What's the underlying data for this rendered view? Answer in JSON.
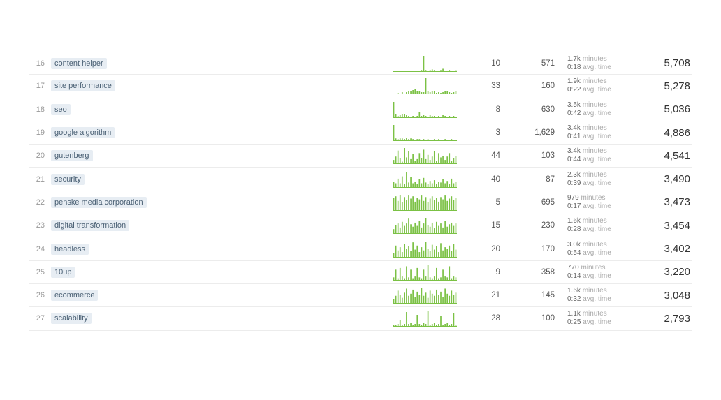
{
  "labels": {
    "minutes": "minutes",
    "avg_time": "avg. time"
  },
  "rows": [
    {
      "rank": 16,
      "tag": "content helper",
      "spark": [
        0,
        0,
        0,
        1,
        0,
        0,
        0,
        0,
        0,
        1,
        0,
        0,
        0,
        2,
        25,
        2,
        1,
        2,
        3,
        2,
        1,
        1,
        2,
        4,
        0,
        1,
        2,
        1,
        1,
        2
      ],
      "col1": "10",
      "col2": "571",
      "minutes": "1.7k",
      "avg_time": "0:18",
      "total": "5,708"
    },
    {
      "rank": 17,
      "tag": "site performance",
      "spark": [
        0,
        0,
        1,
        0,
        2,
        0,
        2,
        4,
        3,
        5,
        6,
        3,
        4,
        2,
        2,
        22,
        3,
        2,
        3,
        4,
        1,
        2,
        1,
        2,
        3,
        4,
        2,
        1,
        2,
        4
      ],
      "col1": "33",
      "col2": "160",
      "minutes": "1.9k",
      "avg_time": "0:22",
      "total": "5,278"
    },
    {
      "rank": 18,
      "tag": "seo",
      "spark": [
        22,
        4,
        2,
        3,
        5,
        4,
        3,
        2,
        1,
        2,
        1,
        2,
        7,
        2,
        3,
        2,
        1,
        3,
        2,
        2,
        1,
        2,
        1,
        3,
        2,
        1,
        2,
        1,
        2,
        1
      ],
      "col1": "8",
      "col2": "630",
      "minutes": "3.5k",
      "avg_time": "0:42",
      "total": "5,036"
    },
    {
      "rank": 19,
      "tag": "google algorithm",
      "spark": [
        24,
        3,
        2,
        3,
        3,
        2,
        4,
        2,
        3,
        2,
        1,
        2,
        2,
        1,
        2,
        1,
        2,
        1,
        1,
        2,
        1,
        2,
        1,
        1,
        2,
        1,
        1,
        2,
        1,
        1
      ],
      "col1": "3",
      "col2": "1,629",
      "minutes": "3.4k",
      "avg_time": "0:41",
      "total": "4,886"
    },
    {
      "rank": 20,
      "tag": "gutenberg",
      "spark": [
        4,
        8,
        15,
        6,
        2,
        18,
        7,
        14,
        5,
        11,
        3,
        5,
        12,
        6,
        16,
        5,
        10,
        4,
        8,
        14,
        3,
        12,
        7,
        9,
        4,
        8,
        12,
        3,
        6,
        9
      ],
      "col1": "44",
      "col2": "103",
      "minutes": "3.4k",
      "avg_time": "0:44",
      "total": "4,541"
    },
    {
      "rank": 21,
      "tag": "security",
      "spark": [
        7,
        5,
        11,
        5,
        14,
        4,
        20,
        6,
        13,
        5,
        7,
        4,
        10,
        5,
        12,
        6,
        4,
        8,
        5,
        9,
        4,
        7,
        6,
        10,
        5,
        8,
        4,
        11,
        5,
        7
      ],
      "col1": "40",
      "col2": "87",
      "minutes": "2.3k",
      "avg_time": "0:39",
      "total": "3,490"
    },
    {
      "rank": 22,
      "tag": "penske media corporation",
      "spark": [
        16,
        18,
        12,
        20,
        10,
        17,
        13,
        19,
        15,
        18,
        11,
        16,
        14,
        19,
        12,
        17,
        10,
        15,
        18,
        13,
        16,
        11,
        17,
        14,
        19,
        12,
        15,
        18,
        13,
        16
      ],
      "col1": "5",
      "col2": "695",
      "minutes": "979",
      "avg_time": "0:17",
      "total": "3,473"
    },
    {
      "rank": 23,
      "tag": "digital transformation",
      "spark": [
        5,
        10,
        12,
        7,
        14,
        9,
        12,
        18,
        11,
        8,
        13,
        9,
        15,
        7,
        12,
        19,
        10,
        8,
        13,
        6,
        14,
        9,
        12,
        7,
        15,
        8,
        11,
        13,
        9,
        12
      ],
      "col1": "15",
      "col2": "230",
      "minutes": "1.6k",
      "avg_time": "0:28",
      "total": "3,454"
    },
    {
      "rank": 24,
      "tag": "headless",
      "spark": [
        5,
        14,
        8,
        12,
        6,
        16,
        10,
        13,
        7,
        18,
        9,
        14,
        6,
        12,
        8,
        19,
        10,
        7,
        15,
        9,
        13,
        6,
        17,
        8,
        12,
        10,
        14,
        7,
        16,
        9
      ],
      "col1": "20",
      "col2": "170",
      "minutes": "3.0k",
      "avg_time": "0:54",
      "total": "3,402"
    },
    {
      "rank": 25,
      "tag": "10up",
      "spark": [
        3,
        12,
        2,
        14,
        4,
        2,
        16,
        3,
        12,
        2,
        4,
        14,
        3,
        2,
        12,
        4,
        18,
        3,
        2,
        4,
        14,
        2,
        3,
        12,
        4,
        3,
        16,
        2,
        4,
        3
      ],
      "col1": "9",
      "col2": "358",
      "minutes": "770",
      "avg_time": "0:14",
      "total": "3,220"
    },
    {
      "rank": 26,
      "tag": "ecommerce",
      "spark": [
        4,
        7,
        12,
        8,
        5,
        10,
        14,
        7,
        9,
        13,
        6,
        11,
        8,
        15,
        7,
        10,
        5,
        12,
        9,
        7,
        13,
        8,
        11,
        6,
        14,
        9,
        7,
        12,
        8,
        10
      ],
      "col1": "21",
      "col2": "145",
      "minutes": "1.6k",
      "avg_time": "0:32",
      "total": "3,048"
    },
    {
      "rank": 27,
      "tag": "scalability",
      "spark": [
        2,
        2,
        3,
        8,
        2,
        3,
        20,
        3,
        4,
        2,
        3,
        16,
        3,
        2,
        4,
        3,
        22,
        2,
        3,
        4,
        2,
        3,
        14,
        2,
        3,
        4,
        2,
        3,
        18,
        2
      ],
      "col1": "28",
      "col2": "100",
      "minutes": "1.1k",
      "avg_time": "0:25",
      "total": "2,793"
    }
  ]
}
